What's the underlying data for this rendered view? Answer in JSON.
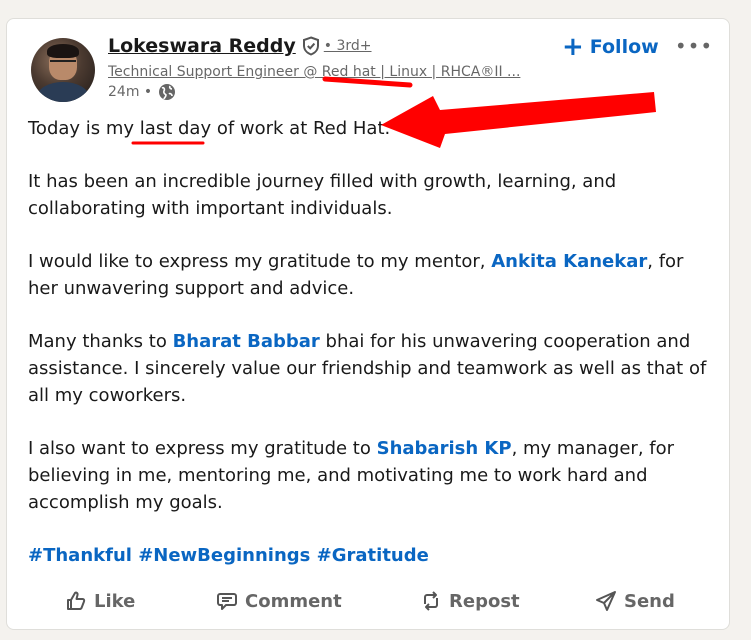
{
  "post": {
    "author": {
      "name": "Lokeswara Reddy",
      "degree": "• 3rd+",
      "headline": "Technical Support Engineer @ Red hat | Linux | RHCA®II ...",
      "time": "24m •",
      "avatar_icon": "profile-photo"
    },
    "follow_label": "Follow",
    "more_label": "•••",
    "text": {
      "p1_before": "Today is my ",
      "p1_highlight": "last day",
      "p1_after": " of work at Red Hat.",
      "p2": "It has been an incredible journey filled with growth, learning, and collaborating with important individuals.",
      "p3_before": "I would like to express my gratitude to my mentor, ",
      "p3_mention": "Ankita Kanekar",
      "p3_after": ", for her unwavering support and advice.",
      "p4_before": "Many thanks to ",
      "p4_mention": "Bharat Babbar",
      "p4_after": " bhai for his unwavering cooperation and assistance. I sincerely value our friendship and teamwork as well as that of all my coworkers.",
      "p5_before": "I also want to express my gratitude to ",
      "p5_mention": "Shabarish KP",
      "p5_after": ", my manager, for believing in me, mentoring me, and motivating me to work hard and accomplish my goals."
    },
    "hashtags": [
      "#Thankful",
      "#NewBeginnings",
      "#Gratitude"
    ],
    "actions": {
      "like": "Like",
      "comment": "Comment",
      "repost": "Repost",
      "send": "Send"
    }
  },
  "colors": {
    "link": "#0a66c2",
    "annotation": "#ff0000",
    "background": "#f4f2ee"
  }
}
